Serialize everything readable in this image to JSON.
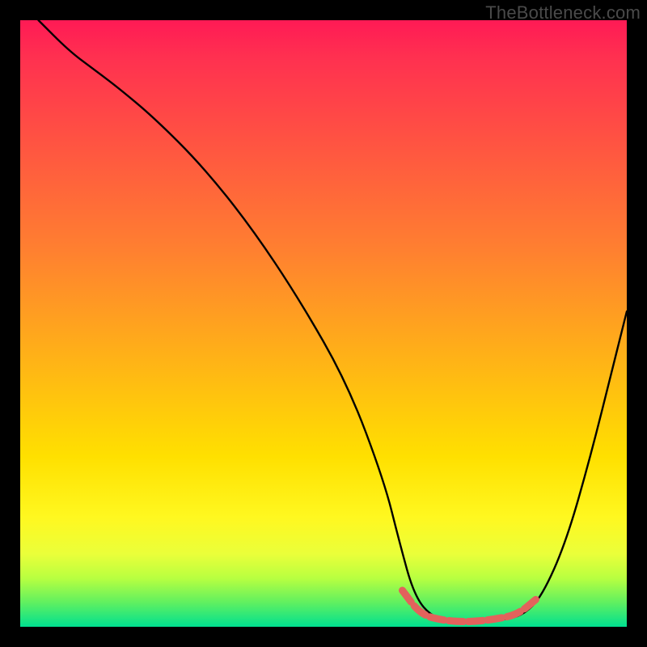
{
  "watermark": "TheBottleneck.com",
  "chart_data": {
    "type": "line",
    "title": "",
    "xlabel": "",
    "ylabel": "",
    "xlim": [
      0,
      100
    ],
    "ylim": [
      0,
      100
    ],
    "series": [
      {
        "name": "bottleneck-curve",
        "comment": "x,y pairs in percent of plot area; y=0 is bottom (green), y=100 is top (red). Describes a steep descending curve from top-left to a flat minimum around x=66-84, then rising toward the right edge.",
        "x": [
          3,
          8,
          12,
          16,
          22,
          30,
          38,
          46,
          54,
          60,
          62.5,
          65,
          68,
          72,
          76,
          80,
          83,
          86,
          90,
          94,
          98,
          100
        ],
        "y": [
          100,
          95,
          92,
          89,
          84,
          76,
          66,
          54,
          40,
          24,
          14,
          5,
          1.5,
          0.8,
          0.8,
          1.2,
          2,
          5,
          14,
          28,
          44,
          52
        ]
      },
      {
        "name": "highlight-band",
        "comment": "Thicker red/coral segment marking the flat minimum region of the curve.",
        "x": [
          63,
          66,
          70,
          74,
          78,
          82,
          85
        ],
        "y": [
          6,
          2,
          1,
          0.8,
          1.2,
          2,
          4.5
        ]
      }
    ],
    "colors": {
      "curve": "#000000",
      "highlight": "#e2625c",
      "gradient_top": "#ff1a55",
      "gradient_bottom": "#00e090"
    }
  }
}
